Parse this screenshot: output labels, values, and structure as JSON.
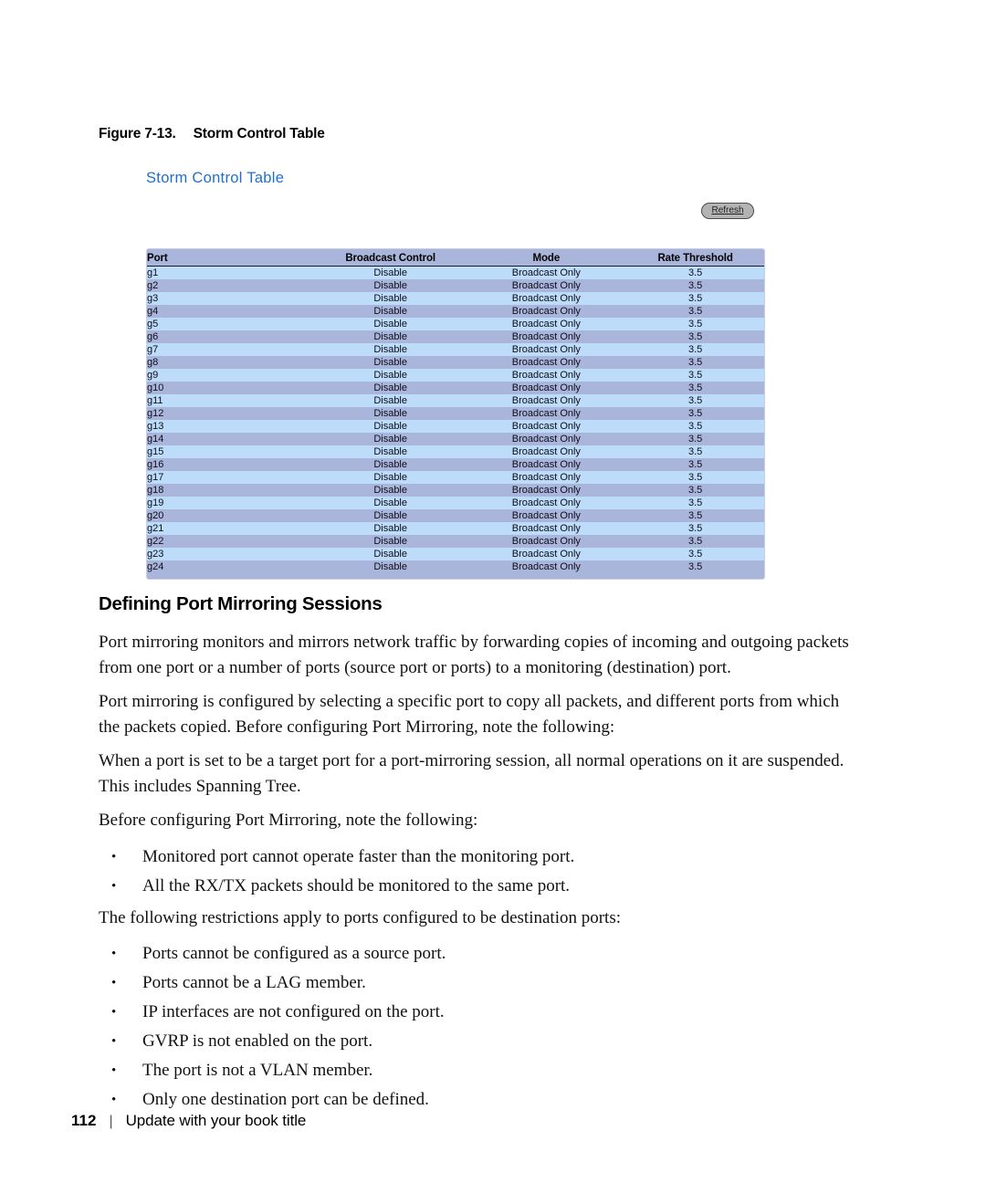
{
  "figure": {
    "number": "Figure 7-13.",
    "caption": "Storm Control Table"
  },
  "screenshot": {
    "title": "Storm Control Table",
    "title_color": "#1f6fd0",
    "refresh_label": "Refresh",
    "table": {
      "headers": [
        "Port",
        "Broadcast Control",
        "Mode",
        "Rate Threshold"
      ],
      "row_color_odd": "#bcdcfa",
      "row_color_even": "#a9b5da",
      "rows": [
        [
          "g1",
          "Disable",
          "Broadcast Only",
          "3.5"
        ],
        [
          "g2",
          "Disable",
          "Broadcast Only",
          "3.5"
        ],
        [
          "g3",
          "Disable",
          "Broadcast Only",
          "3.5"
        ],
        [
          "g4",
          "Disable",
          "Broadcast Only",
          "3.5"
        ],
        [
          "g5",
          "Disable",
          "Broadcast Only",
          "3.5"
        ],
        [
          "g6",
          "Disable",
          "Broadcast Only",
          "3.5"
        ],
        [
          "g7",
          "Disable",
          "Broadcast Only",
          "3.5"
        ],
        [
          "g8",
          "Disable",
          "Broadcast Only",
          "3.5"
        ],
        [
          "g9",
          "Disable",
          "Broadcast Only",
          "3.5"
        ],
        [
          "g10",
          "Disable",
          "Broadcast Only",
          "3.5"
        ],
        [
          "g11",
          "Disable",
          "Broadcast Only",
          "3.5"
        ],
        [
          "g12",
          "Disable",
          "Broadcast Only",
          "3.5"
        ],
        [
          "g13",
          "Disable",
          "Broadcast Only",
          "3.5"
        ],
        [
          "g14",
          "Disable",
          "Broadcast Only",
          "3.5"
        ],
        [
          "g15",
          "Disable",
          "Broadcast Only",
          "3.5"
        ],
        [
          "g16",
          "Disable",
          "Broadcast Only",
          "3.5"
        ],
        [
          "g17",
          "Disable",
          "Broadcast Only",
          "3.5"
        ],
        [
          "g18",
          "Disable",
          "Broadcast Only",
          "3.5"
        ],
        [
          "g19",
          "Disable",
          "Broadcast Only",
          "3.5"
        ],
        [
          "g20",
          "Disable",
          "Broadcast Only",
          "3.5"
        ],
        [
          "g21",
          "Disable",
          "Broadcast Only",
          "3.5"
        ],
        [
          "g22",
          "Disable",
          "Broadcast Only",
          "3.5"
        ],
        [
          "g23",
          "Disable",
          "Broadcast Only",
          "3.5"
        ],
        [
          "g24",
          "Disable",
          "Broadcast Only",
          "3.5"
        ]
      ]
    }
  },
  "section": {
    "heading": "Defining Port Mirroring Sessions",
    "paragraphs": [
      "Port mirroring monitors and mirrors network traffic by forwarding copies of incoming and outgoing packets from one port or a number of ports (source port or ports) to a monitoring (destination) port.",
      "Port mirroring is configured by selecting a specific port to copy all packets, and different ports from which the packets copied. Before configuring Port Mirroring, note the following:",
      "When a port is set to be a target port for a port-mirroring session, all normal operations on it are suspended. This includes Spanning Tree.",
      "Before configuring Port Mirroring, note the following:"
    ],
    "bullets_first": [
      "Monitored port cannot operate faster than the monitoring port.",
      "All the RX/TX packets should be monitored to the same port."
    ],
    "restrictions_intro": "The following restrictions apply to ports configured to be destination ports:",
    "bullets_second": [
      "Ports cannot be configured as a source port.",
      "Ports cannot be a LAG member.",
      "IP interfaces are not configured on the port.",
      "GVRP is not enabled on the port.",
      "The port is not a VLAN member.",
      "Only one destination port can be defined."
    ]
  },
  "footer": {
    "page_number": "112",
    "separator": "|",
    "book_title": "Update with your book title"
  }
}
